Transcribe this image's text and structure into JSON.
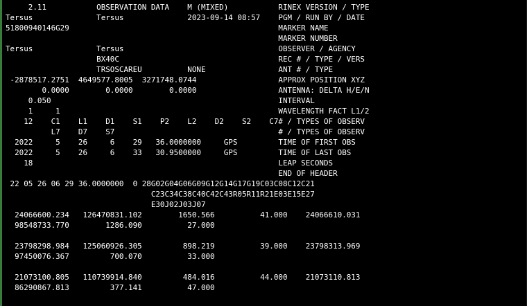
{
  "colors": {
    "background": "#000000",
    "text": "#ffffff",
    "left_strip": "#3a7a3a"
  },
  "lines": [
    "     2.11           OBSERVATION DATA    M (MIXED)           RINEX VERSION / TYPE",
    "Tersus              Tersus              2023-09-14 08:57    PGM / RUN BY / DATE",
    "51800940146G29                                              MARKER NAME",
    "                                                            MARKER NUMBER",
    "Tersus              Tersus                                  OBSERVER / AGENCY",
    "                    BX40C                                   REC # / TYPE / VERS",
    "                    TRSOSCAREU          NONE                ANT # / TYPE",
    " -2878517.2751  4649577.8005  3271748.0744                  APPROX POSITION XYZ",
    "        0.0000        0.0000        0.0000                  ANTENNA: DELTA H/E/N",
    "     0.050                                                  INTERVAL",
    "     1     1                                                WAVELENGTH FACT L1/2",
    "    12    C1    L1    D1    S1    P2    L2    D2    S2    C7# / TYPES OF OBSERV",
    "          L7    D7    S7                                    # / TYPES OF OBSERV",
    "  2022     5    26     6    29   36.0000000     GPS         TIME OF FIRST OBS",
    "  2022     5    26     6    33   30.9500000     GPS         TIME OF LAST OBS",
    "    18                                                      LEAP SECONDS",
    "                                                            END OF HEADER",
    " 22 05 26 06 29 36.0000000  0 28G02G04G06G09G12G14G17G19C03C08C12C21",
    "                                C23C34C38C40C42C43R05R11R21E03E15E27",
    "                                E30J02J03J07",
    "  24066600.234   126470831.102        1650.566          41.000    24066610.031",
    "  98548733.770        1286.090          27.000",
    "",
    "  23798298.984   125060926.305         898.219          39.000    23798313.969",
    "  97450076.367         700.070          33.000",
    "",
    "  21073100.805   110739914.840         484.016          44.000    21073110.813",
    "  86290867.813         377.141          47.000"
  ]
}
